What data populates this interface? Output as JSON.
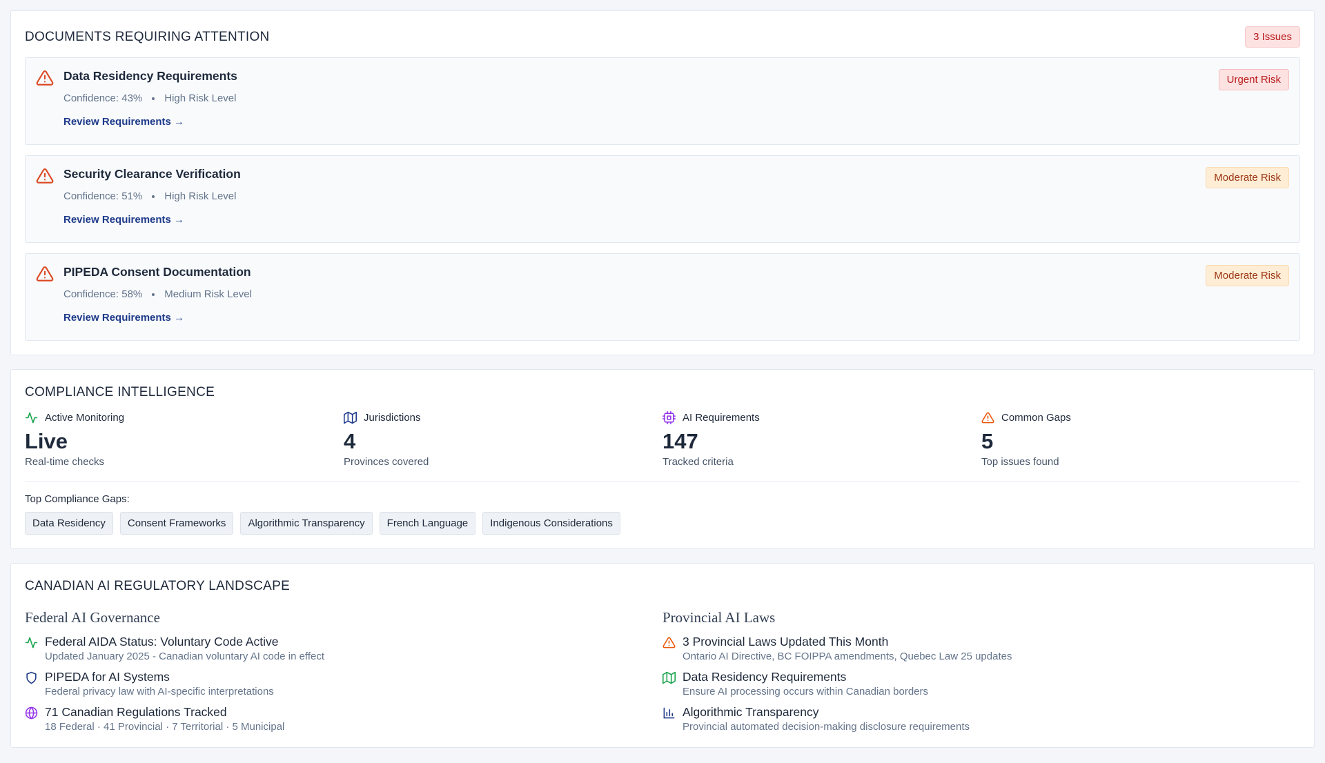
{
  "attention": {
    "title": "DOCUMENTS REQUIRING ATTENTION",
    "badge": "3 Issues",
    "docs": [
      {
        "title": "Data Residency Requirements",
        "confidence": "Confidence: 43%",
        "risk_level": "High Risk Level",
        "link": "Review Requirements →",
        "badge": "Urgent Risk"
      },
      {
        "title": "Security Clearance Verification",
        "confidence": "Confidence: 51%",
        "risk_level": "High Risk Level",
        "link": "Review Requirements →",
        "badge": "Moderate Risk"
      },
      {
        "title": "PIPEDA Consent Documentation",
        "confidence": "Confidence: 58%",
        "risk_level": "Medium Risk Level",
        "link": "Review Requirements →",
        "badge": "Moderate Risk"
      }
    ]
  },
  "intelligence": {
    "title": "COMPLIANCE INTELLIGENCE",
    "stats": [
      {
        "label": "Active Monitoring",
        "value": "Live",
        "sub": "Real-time checks",
        "icon": "activity-icon",
        "color": "#16a34a"
      },
      {
        "label": "Jurisdictions",
        "value": "4",
        "sub": "Provinces covered",
        "icon": "map-icon",
        "color": "#1e3a8a"
      },
      {
        "label": "AI Requirements",
        "value": "147",
        "sub": "Tracked criteria",
        "icon": "cpu-icon",
        "color": "#9333ea"
      },
      {
        "label": "Common Gaps",
        "value": "5",
        "sub": "Top issues found",
        "icon": "warning-icon",
        "color": "#ea580c"
      }
    ],
    "gaps_label": "Top Compliance Gaps:",
    "gaps": [
      "Data Residency",
      "Consent Frameworks",
      "Algorithmic Transparency",
      "French Language",
      "Indigenous Considerations"
    ]
  },
  "landscape": {
    "title": "CANADIAN AI REGULATORY LANDSCAPE",
    "federal": {
      "title": "Federal AI Governance",
      "items": [
        {
          "title": "Federal AIDA Status: Voluntary Code Active",
          "desc": "Updated January 2025 - Canadian voluntary AI code in effect",
          "icon": "activity-icon"
        },
        {
          "title": "PIPEDA for AI Systems",
          "desc": "Federal privacy law with AI-specific interpretations",
          "icon": "shield-icon"
        },
        {
          "title": "71 Canadian Regulations Tracked",
          "desc": "18 Federal · 41 Provincial · 7 Territorial · 5 Municipal",
          "icon": "globe-icon"
        }
      ]
    },
    "provincial": {
      "title": "Provincial AI Laws",
      "items": [
        {
          "title": "3 Provincial Laws Updated This Month",
          "desc": "Ontario AI Directive, BC FOIPPA amendments, Quebec Law 25 updates",
          "icon": "warning-icon"
        },
        {
          "title": "Data Residency Requirements",
          "desc": "Ensure AI processing occurs within Canadian borders",
          "icon": "map-icon"
        },
        {
          "title": "Algorithmic Transparency",
          "desc": "Provincial automated decision-making disclosure requirements",
          "icon": "bar-chart-icon"
        }
      ]
    }
  }
}
